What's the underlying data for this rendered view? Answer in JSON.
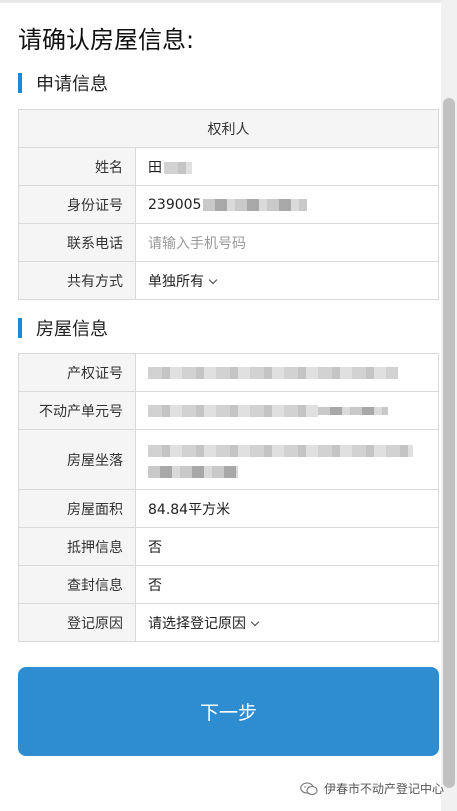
{
  "page": {
    "title": "请确认房屋信息:"
  },
  "apply_section": {
    "heading": "申请信息",
    "table_header": "权利人",
    "rows": [
      {
        "label": "姓名",
        "value": "田"
      },
      {
        "label": "身份证号",
        "value": "239005"
      },
      {
        "label": "联系电话",
        "placeholder": "请输入手机号码"
      },
      {
        "label": "共有方式",
        "value": "单独所有"
      }
    ]
  },
  "house_section": {
    "heading": "房屋信息",
    "rows": [
      {
        "label": "产权证号"
      },
      {
        "label": "不动产单元号"
      },
      {
        "label": "房屋坐落"
      },
      {
        "label": "房屋面积",
        "value": "84.84平方米"
      },
      {
        "label": "抵押信息",
        "value": "否"
      },
      {
        "label": "查封信息",
        "value": "否"
      },
      {
        "label": "登记原因",
        "value": "请选择登记原因"
      }
    ]
  },
  "next_button": {
    "label": "下一步"
  },
  "footer": {
    "text": "伊春市不动产登记中心"
  },
  "colors": {
    "accent": "#2e8cd0",
    "section_bar": "#1a8ad6",
    "label_bg": "#f5f5f5"
  }
}
